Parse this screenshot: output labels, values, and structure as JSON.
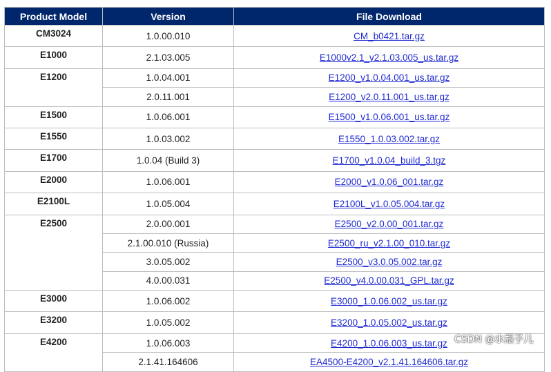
{
  "table": {
    "headers": [
      "Product Model",
      "Version",
      "File Download"
    ],
    "groups": [
      {
        "model": "CM3024",
        "rows": [
          [
            "1.0.00.010",
            "CM_b0421.tar.gz"
          ]
        ]
      },
      {
        "model": "E1000",
        "rows": [
          [
            "2.1.03.005",
            "E1000v2.1_v2.1.03.005_us.tar.gz"
          ]
        ]
      },
      {
        "model": "E1200",
        "rows": [
          [
            "1.0.04.001",
            "E1200_v1.0.04.001_us.tar.gz"
          ],
          [
            "2.0.11.001",
            "E1200_v2.0.11.001_us.tar.gz"
          ]
        ]
      },
      {
        "model": "E1500",
        "rows": [
          [
            "1.0.06.001",
            "E1500_v1.0.06.001_us.tar.gz"
          ]
        ]
      },
      {
        "model": "E1550",
        "rows": [
          [
            "1.0.03.002",
            "E1550_1.0.03.002.tar.gz"
          ]
        ]
      },
      {
        "model": "E1700",
        "rows": [
          [
            "1.0.04 (Build 3)",
            "E1700_v1.0.04_build_3.tgz"
          ]
        ]
      },
      {
        "model": "E2000",
        "rows": [
          [
            "1.0.06.001",
            "E2000_v1.0.06_001.tar.gz"
          ]
        ]
      },
      {
        "model": "E2100L",
        "rows": [
          [
            "1.0.05.004",
            "E2100L_v1.0.05.004.tar.gz"
          ]
        ]
      },
      {
        "model": "E2500",
        "rows": [
          [
            "2.0.00.001",
            "E2500_v2.0.00_001.tar.gz"
          ],
          [
            "2.1.00.010 (Russia)",
            "E2500_ru_v2.1.00_010.tar.gz"
          ],
          [
            "3.0.05.002",
            "E2500_v3.0.05.002.tar.gz"
          ],
          [
            "4.0.00.031",
            "E2500_v4.0.00.031_GPL.tar.gz"
          ]
        ]
      },
      {
        "model": "E3000",
        "rows": [
          [
            "1.0.06.002",
            "E3000_1.0.06.002_us.tar.gz"
          ]
        ]
      },
      {
        "model": "E3200",
        "rows": [
          [
            "1.0.05.002",
            "E3200_1.0.05.002_us.tar.gz"
          ]
        ]
      },
      {
        "model": "E4200",
        "rows": [
          [
            "1.0.06.003",
            "E4200_1.0.06.003_us.tar.gz"
          ],
          [
            "2.1.41.164606",
            "EA4500-E4200_v2.1.41.164606.tar.gz"
          ]
        ]
      }
    ]
  },
  "watermark": "CSDN @水瓶子儿",
  "colors": {
    "header_bg": "#00266b",
    "header_text": "#ffffff",
    "link": "#1f2ad1",
    "border": "#bdbdbd"
  }
}
